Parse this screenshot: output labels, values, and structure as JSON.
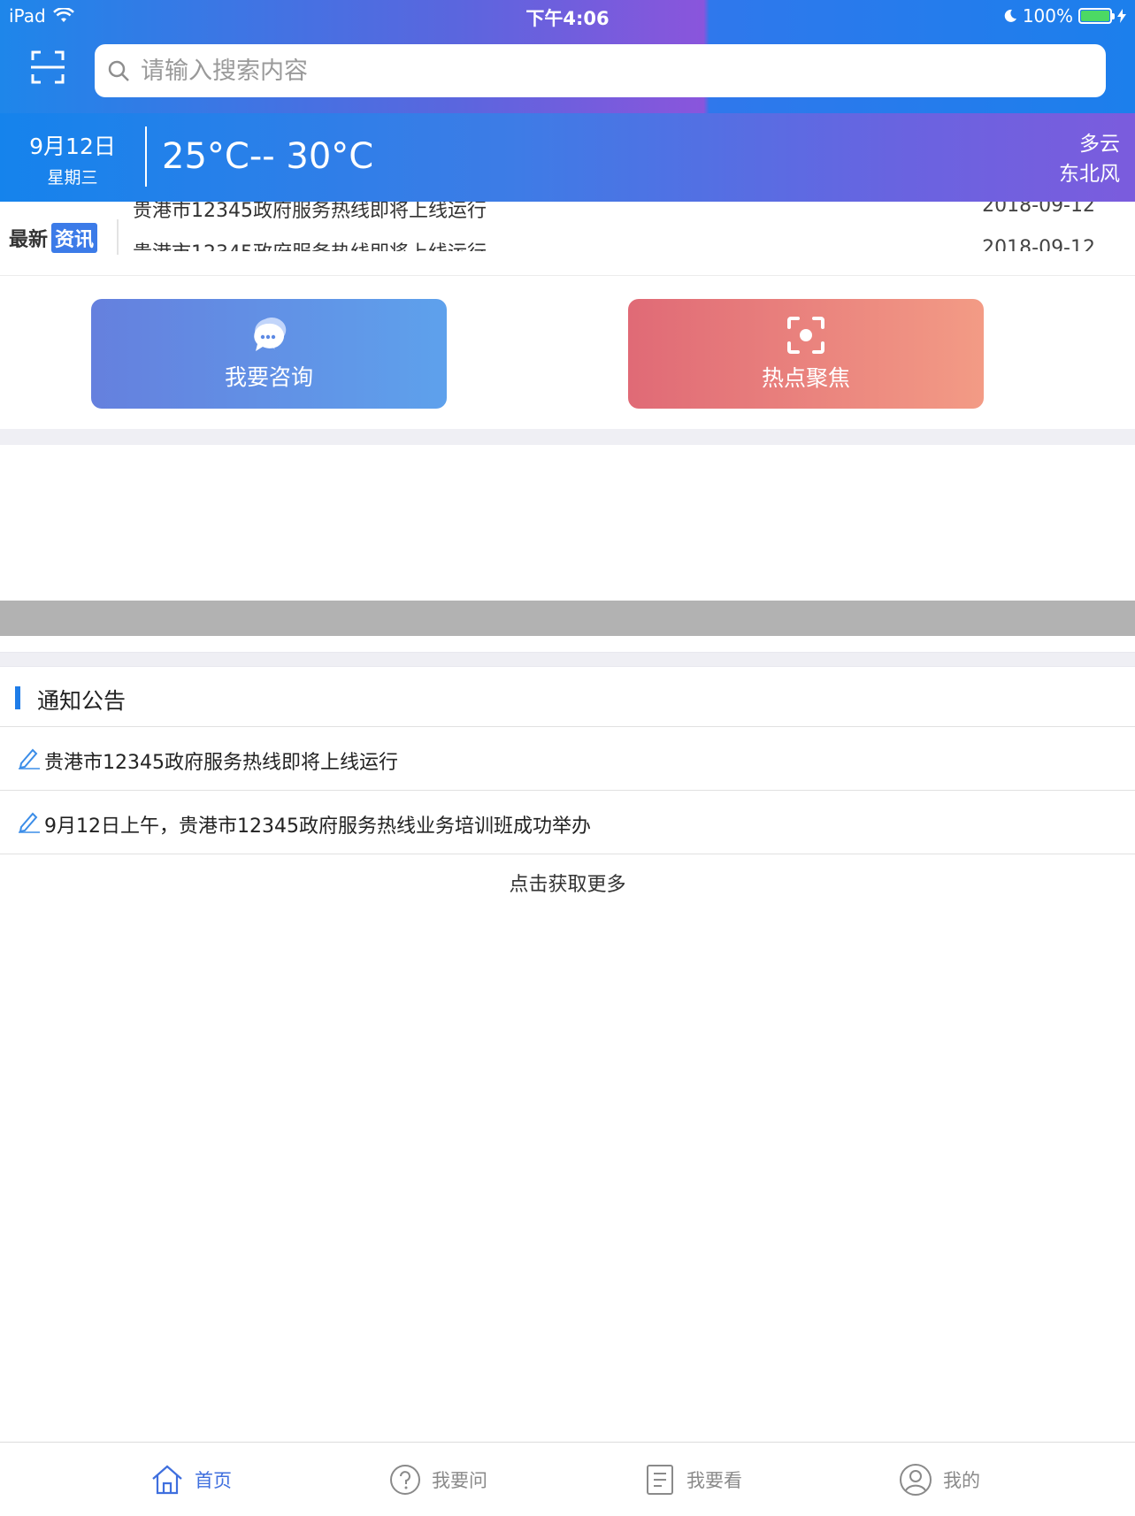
{
  "status_bar": {
    "device": "iPad",
    "time": "下午4:06",
    "battery": "100%",
    "battery_level": 1.0
  },
  "search": {
    "placeholder": "请输入搜索内容"
  },
  "weather": {
    "date": "9月12日",
    "weekday": "星期三",
    "temperature": "25°C-- 30°C",
    "condition": "多云",
    "wind": "东北风"
  },
  "news": {
    "label": "最新",
    "badge": "资讯",
    "items": [
      {
        "title": "贵港市12345政府服务热线即将上线运行",
        "date": "2018-09-12"
      },
      {
        "title": "贵港市12345政府服务热线即将上线运行",
        "date": "2018-09-12"
      }
    ]
  },
  "actions": {
    "consult": "我要咨询",
    "hot": "热点聚焦"
  },
  "notices": {
    "title": "通知公告",
    "items": [
      "贵港市12345政府服务热线即将上线运行",
      "9月12日上午，贵港市12345政府服务热线业务培训班成功举办"
    ],
    "more": "点击获取更多"
  },
  "tabs": [
    {
      "label": "首页",
      "icon": "home-icon",
      "active": true
    },
    {
      "label": "我要问",
      "icon": "question-icon",
      "active": false
    },
    {
      "label": "我要看",
      "icon": "document-icon",
      "active": false
    },
    {
      "label": "我的",
      "icon": "user-icon",
      "active": false
    }
  ],
  "colors": {
    "accent": "#1f7de8",
    "consult_button": "#5e8ee6",
    "hot_button": "#e97a7c",
    "tab_active": "#3f6fde"
  }
}
